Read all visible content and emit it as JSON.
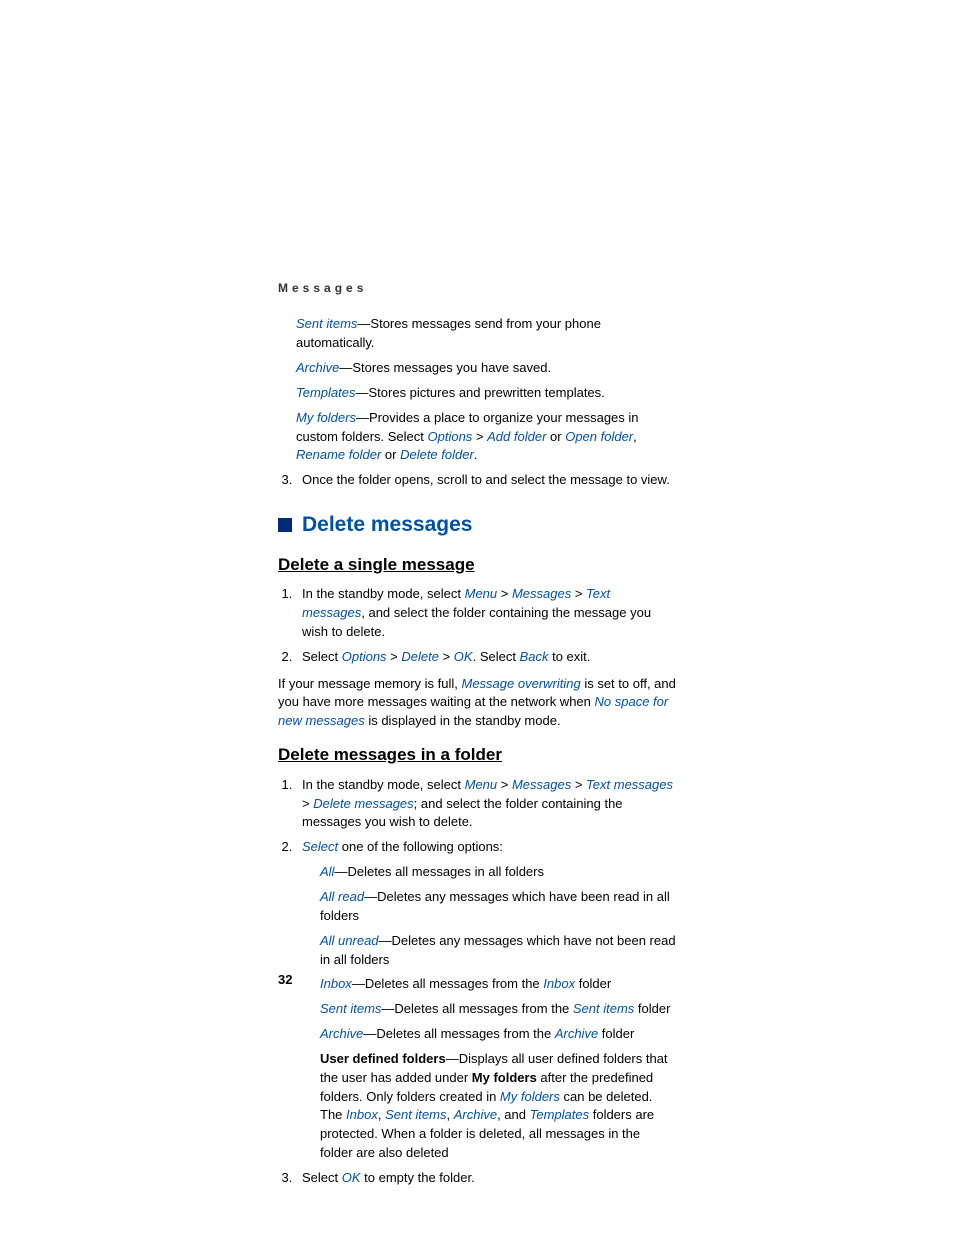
{
  "header": {
    "chapter": "Messages"
  },
  "folders": {
    "sent_items": {
      "name": "Sent items",
      "desc": "—Stores messages send from your phone automatically."
    },
    "archive": {
      "name": "Archive",
      "desc": "—Stores messages you have saved."
    },
    "templates": {
      "name": "Templates",
      "desc": "—Stores pictures and prewritten templates."
    },
    "my_folders": {
      "name": "My folders",
      "desc1": "—Provides a place to organize your messages in custom folders. Select ",
      "options": "Options",
      "gt1": " > ",
      "add_folder": "Add folder",
      "or1": " or ",
      "open_folder": "Open folder",
      "comma": ", ",
      "rename_folder": "Rename folder",
      "or2": " or ",
      "delete_folder": "Delete folder",
      "period": "."
    }
  },
  "step3": "Once the folder opens, scroll to and select the message to view.",
  "section": {
    "title": "Delete messages"
  },
  "sub1": {
    "title": "Delete a single message",
    "s1_pre": "In the standby mode, select ",
    "menu": "Menu",
    "gt": " > ",
    "messages": "Messages",
    "text_messages": "Text messages",
    "s1_post": ", and select the folder containing the message you wish to delete.",
    "s2_pre": "Select ",
    "options": "Options",
    "delete": "Delete",
    "ok": "OK",
    "s2_mid": ". Select ",
    "back": "Back",
    "s2_post": " to exit."
  },
  "memory": {
    "pre": "If your message memory is full, ",
    "overwriting": "Message overwriting",
    "mid": " is set to off, and you have more messages waiting at the network when ",
    "nospace": "No space for new messages",
    "post": " is displayed in the standby mode."
  },
  "sub2": {
    "title": "Delete messages in a folder",
    "s1_pre": "In the standby mode, select ",
    "menu": "Menu",
    "gt": " > ",
    "messages": "Messages",
    "text_messages": "Text messages",
    "delete_messages": "Delete messages",
    "s1_post": "; and select the folder containing the messages you wish to delete.",
    "s2_select": "Select",
    "s2_post": " one of the following options:",
    "opt_all": {
      "name": "All",
      "desc": "—Deletes all messages in all folders"
    },
    "opt_all_read": {
      "name": "All read",
      "desc": "—Deletes any messages which have been read in all folders"
    },
    "opt_all_unread": {
      "name": "All unread",
      "desc": "—Deletes any messages which have not been read in all folders"
    },
    "opt_inbox": {
      "name": "Inbox",
      "pre": "—Deletes all messages from the ",
      "ref": "Inbox",
      "post": " folder"
    },
    "opt_sent": {
      "name": "Sent items",
      "pre": "—Deletes all messages from the ",
      "ref": "Sent items",
      "post": " folder"
    },
    "opt_archive": {
      "name": "Archive",
      "pre": "—Deletes all messages from the ",
      "ref": "Archive",
      "post": " folder"
    },
    "opt_udf": {
      "title": "User defined folders",
      "t1": "—Displays all user defined folders that the user has added under ",
      "myfolders_bold": "My folders",
      "t2": " after the predefined folders. Only folders created in ",
      "myfolders": "My folders",
      "t3": " can be deleted. The ",
      "inbox": "Inbox",
      "c1": ", ",
      "sentitems": "Sent items",
      "c2": ", ",
      "archive": "Archive",
      "and": ", and ",
      "templates": "Templates",
      "t4": " folders are protected. When a folder is deleted, all messages in the folder are also deleted"
    },
    "s3_pre": "Select ",
    "ok": "OK",
    "s3_post": " to empty the folder."
  },
  "page_number": "32"
}
